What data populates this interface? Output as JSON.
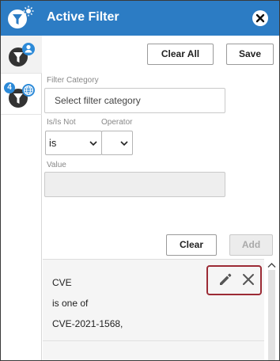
{
  "header": {
    "title": "Active Filter",
    "accent": "#2c7cc4"
  },
  "sidebar": {
    "items": [
      {
        "icon": "user-filter-icon"
      },
      {
        "icon": "global-filter-icon",
        "badge": "4"
      }
    ]
  },
  "toolbar": {
    "clear_all_label": "Clear All",
    "save_label": "Save"
  },
  "form": {
    "category_label": "Filter Category",
    "category_placeholder": "Select filter category",
    "is_label": "Is/Is Not",
    "is_value": "is",
    "operator_label": "Operator",
    "operator_value": "",
    "value_label": "Value",
    "clear_label": "Clear",
    "add_label": "Add"
  },
  "filters": [
    {
      "category": "CVE",
      "condition": "is one of",
      "value": "CVE-2021-1568,"
    }
  ],
  "colors": {
    "highlight": "#9c2b35"
  }
}
